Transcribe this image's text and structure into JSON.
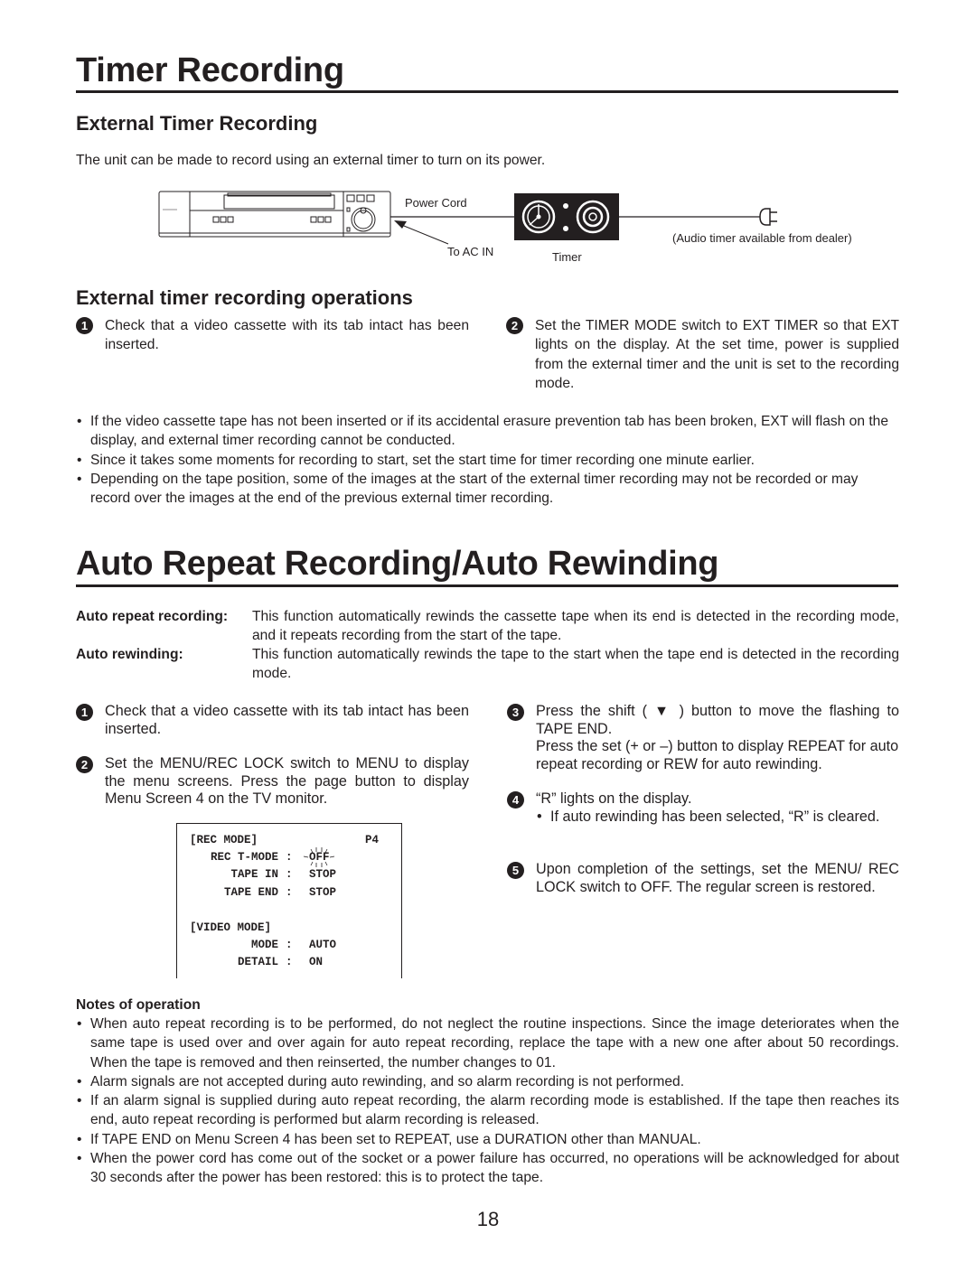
{
  "page": {
    "number": "18"
  },
  "section1": {
    "title": "Timer Recording",
    "subsection1": {
      "title": "External Timer Recording",
      "intro": "The unit can be made to record using an external timer to turn on its power.",
      "diagram": {
        "labels": {
          "power_cord": "Power Cord",
          "to_ac_in": "To AC IN",
          "timer": "Timer",
          "audio_timer_note": "(Audio timer available from dealer)"
        }
      }
    },
    "subsection2": {
      "title": "External timer recording operations",
      "steps": [
        {
          "number": "1",
          "text": "Check that a video cassette with its tab intact has been inserted."
        },
        {
          "number": "2",
          "text": "Set the TIMER MODE switch to EXT TIMER so that EXT lights on the display. At the set time, power is supplied from the external timer and the unit is set to the recording mode."
        }
      ],
      "notes": [
        "If the video cassette tape has not been inserted or if its accidental erasure prevention tab has been broken, EXT will flash on the display, and external timer recording cannot be conducted.",
        "Since it takes some moments for recording to start, set the start time for timer recording one minute earlier.",
        "Depending on the tape position, some of the images at the start of the external timer recording may not be recorded or may record over the images at the end of the previous external timer recording."
      ]
    }
  },
  "section2": {
    "title": "Auto Repeat Recording/Auto Rewinding",
    "definitions": [
      {
        "term": "Auto repeat recording:",
        "text": "This function automatically rewinds the cassette tape when its end is detected in the recording mode, and it repeats recording from the start of the tape."
      },
      {
        "term": "Auto rewinding:",
        "text": "This function automatically rewinds the tape to the start when the tape end is detected in the recording mode."
      }
    ],
    "steps_left": [
      {
        "number": "1",
        "text": "Check that a video cassette with its tab intact has been inserted."
      },
      {
        "number": "2",
        "text": "Set the MENU/REC LOCK switch to MENU to display the menu screens. Press the page button to display Menu Screen 4 on the TV monitor."
      }
    ],
    "steps_right": [
      {
        "number": "3",
        "text_a": "Press the shift ( ▼ ) button to move the flashing to TAPE END.",
        "text_b": "Press the set (+ or –) button to display REPEAT for auto repeat recording or REW for auto rewinding."
      },
      {
        "number": "4",
        "text": "“R” lights on the display.",
        "sub_bullet": "If auto rewinding has been selected, “R” is cleared."
      },
      {
        "number": "5",
        "text": "Upon completion of the settings, set the MENU/ REC LOCK switch to OFF. The regular screen is restored."
      }
    ],
    "menu_screen": {
      "header": "[REC MODE]",
      "page": "P4",
      "rows": [
        {
          "label": "REC T-MODE",
          "sep": ":",
          "value": "OFF",
          "flashing": true
        },
        {
          "label": "TAPE IN",
          "sep": ":",
          "value": "STOP"
        },
        {
          "label": "TAPE END",
          "sep": ":",
          "value": "STOP"
        }
      ],
      "header2": "[VIDEO MODE]",
      "rows2": [
        {
          "label": "MODE",
          "sep": ":",
          "value": "AUTO"
        },
        {
          "label": "DETAIL",
          "sep": ":",
          "value": "ON"
        }
      ]
    },
    "notes_title": "Notes of operation",
    "notes": [
      "When auto repeat recording is to be performed, do not neglect the routine inspections. Since the image deteriorates when the same tape is used over and over again for auto repeat recording, replace the tape with a new one after about 50 recordings. When the tape is removed and then reinserted, the number changes to 01.",
      "Alarm signals are not accepted during auto rewinding, and so alarm recording is not performed.",
      "If an alarm signal is supplied during auto repeat recording, the alarm recording mode is established. If the tape then reaches its end, auto repeat recording is performed but alarm recording is released.",
      "If TAPE END on Menu Screen 4 has been set to REPEAT, use a DURATION other than MANUAL.",
      "When the power cord has come out of the socket or a power failure has occurred, no operations will be acknowledged for about 30 seconds after the power has been restored: this is to protect the tape."
    ]
  }
}
